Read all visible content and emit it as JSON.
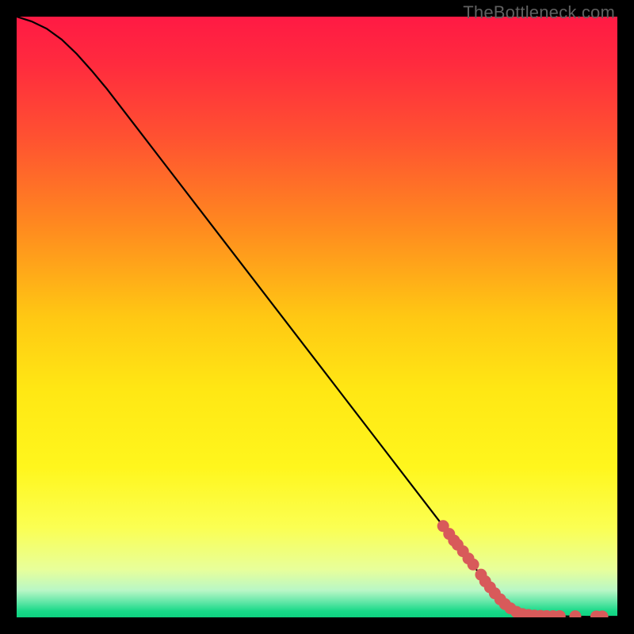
{
  "watermark": "TheBottleneck.com",
  "chart_data": {
    "type": "line",
    "title": "",
    "xlabel": "",
    "ylabel": "",
    "xlim": [
      0,
      100
    ],
    "ylim": [
      0,
      100
    ],
    "background_gradient": {
      "stops": [
        {
          "offset": 0.0,
          "color": "#ff1a44"
        },
        {
          "offset": 0.08,
          "color": "#ff2b3e"
        },
        {
          "offset": 0.2,
          "color": "#ff5131"
        },
        {
          "offset": 0.35,
          "color": "#ff8a1f"
        },
        {
          "offset": 0.5,
          "color": "#ffc813"
        },
        {
          "offset": 0.62,
          "color": "#ffe714"
        },
        {
          "offset": 0.75,
          "color": "#fff61d"
        },
        {
          "offset": 0.85,
          "color": "#fbff52"
        },
        {
          "offset": 0.92,
          "color": "#e8ff9a"
        },
        {
          "offset": 0.955,
          "color": "#b9f7c6"
        },
        {
          "offset": 0.975,
          "color": "#5fe6a6"
        },
        {
          "offset": 0.99,
          "color": "#17d988"
        },
        {
          "offset": 1.0,
          "color": "#0fd180"
        }
      ]
    },
    "curve": [
      {
        "x": 0.0,
        "y": 100.0
      },
      {
        "x": 2.5,
        "y": 99.2
      },
      {
        "x": 5.0,
        "y": 98.0
      },
      {
        "x": 7.5,
        "y": 96.2
      },
      {
        "x": 10.0,
        "y": 93.8
      },
      {
        "x": 12.5,
        "y": 91.0
      },
      {
        "x": 15.0,
        "y": 88.0
      },
      {
        "x": 20.0,
        "y": 81.5
      },
      {
        "x": 25.0,
        "y": 75.0
      },
      {
        "x": 30.0,
        "y": 68.5
      },
      {
        "x": 35.0,
        "y": 62.0
      },
      {
        "x": 40.0,
        "y": 55.5
      },
      {
        "x": 45.0,
        "y": 49.0
      },
      {
        "x": 50.0,
        "y": 42.5
      },
      {
        "x": 55.0,
        "y": 36.0
      },
      {
        "x": 60.0,
        "y": 29.5
      },
      {
        "x": 65.0,
        "y": 23.0
      },
      {
        "x": 70.0,
        "y": 16.5
      },
      {
        "x": 75.0,
        "y": 10.0
      },
      {
        "x": 78.0,
        "y": 6.0
      },
      {
        "x": 81.0,
        "y": 2.5
      },
      {
        "x": 83.0,
        "y": 1.0
      },
      {
        "x": 85.0,
        "y": 0.4
      },
      {
        "x": 90.0,
        "y": 0.2
      },
      {
        "x": 95.0,
        "y": 0.1
      },
      {
        "x": 100.0,
        "y": 0.1
      }
    ],
    "markers": [
      {
        "x": 71.0,
        "y": 15.2
      },
      {
        "x": 72.0,
        "y": 13.9
      },
      {
        "x": 72.8,
        "y": 12.8
      },
      {
        "x": 73.4,
        "y": 12.1
      },
      {
        "x": 74.3,
        "y": 11.0
      },
      {
        "x": 75.2,
        "y": 9.8
      },
      {
        "x": 76.0,
        "y": 8.8
      },
      {
        "x": 77.3,
        "y": 7.1
      },
      {
        "x": 78.0,
        "y": 6.0
      },
      {
        "x": 78.8,
        "y": 5.0
      },
      {
        "x": 79.6,
        "y": 4.0
      },
      {
        "x": 80.5,
        "y": 3.0
      },
      {
        "x": 81.3,
        "y": 2.2
      },
      {
        "x": 82.2,
        "y": 1.5
      },
      {
        "x": 83.2,
        "y": 0.9
      },
      {
        "x": 84.2,
        "y": 0.55
      },
      {
        "x": 85.2,
        "y": 0.4
      },
      {
        "x": 86.2,
        "y": 0.3
      },
      {
        "x": 87.2,
        "y": 0.25
      },
      {
        "x": 88.2,
        "y": 0.22
      },
      {
        "x": 89.3,
        "y": 0.2
      },
      {
        "x": 90.4,
        "y": 0.2
      },
      {
        "x": 93.0,
        "y": 0.18
      },
      {
        "x": 96.5,
        "y": 0.15
      },
      {
        "x": 97.5,
        "y": 0.15
      }
    ],
    "marker_color": "#d85a5a",
    "curve_color": "#000000"
  }
}
